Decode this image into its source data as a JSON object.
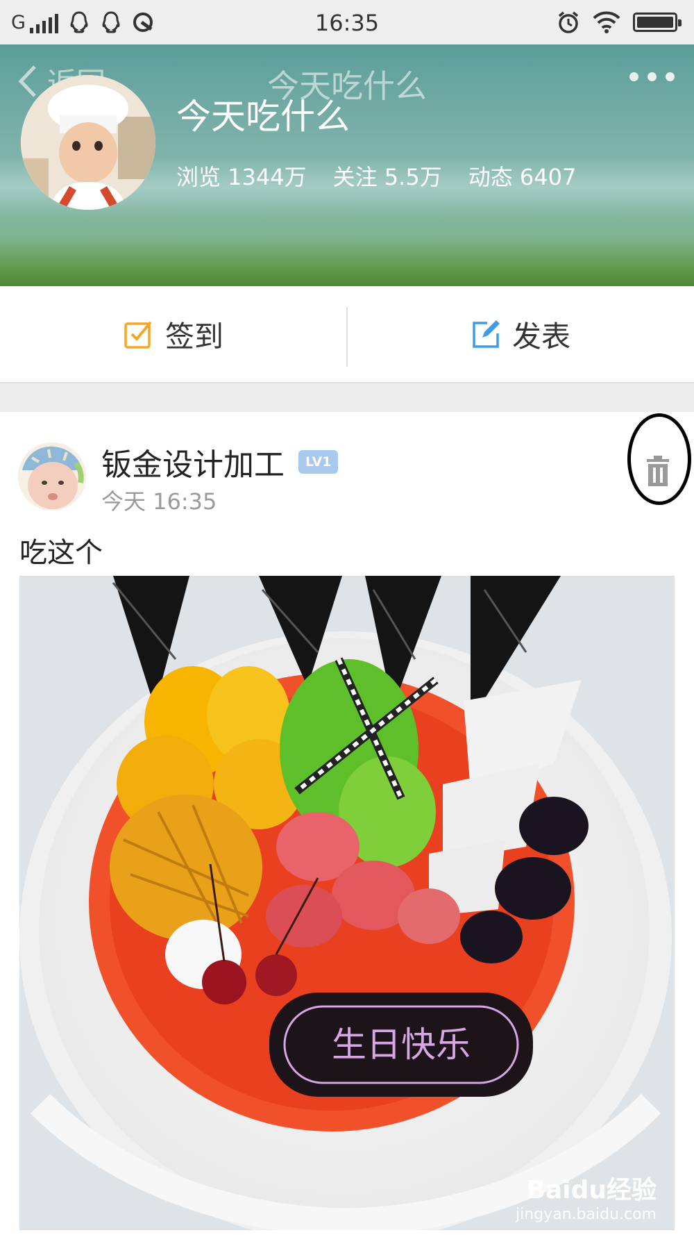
{
  "status_bar": {
    "carrier": "G",
    "time": "16:35",
    "icons": [
      "signal-icon",
      "qq-icon",
      "qq-icon",
      "qq-browser-icon",
      "alarm-icon",
      "wifi-icon",
      "battery-icon"
    ]
  },
  "header": {
    "back_label": "返回",
    "nav_title": "今天吃什么",
    "group_name": "今天吃什么",
    "stats": {
      "views": "浏览 1344万",
      "followers": "关注 5.5万",
      "posts": "动态 6407"
    }
  },
  "actions": {
    "checkin_label": "签到",
    "publish_label": "发表",
    "checkin_icon_color": "#f5a623",
    "publish_icon_color": "#3d9be9"
  },
  "post": {
    "author": "钣金设计加工",
    "level": "LV1",
    "time": "今天 16:35",
    "text": "吃这个",
    "image_description_icon": "cake-photo",
    "cake_text": "生日快乐"
  },
  "watermark": {
    "main": "Baidu经验",
    "sub": "jingyan.baidu.com"
  }
}
